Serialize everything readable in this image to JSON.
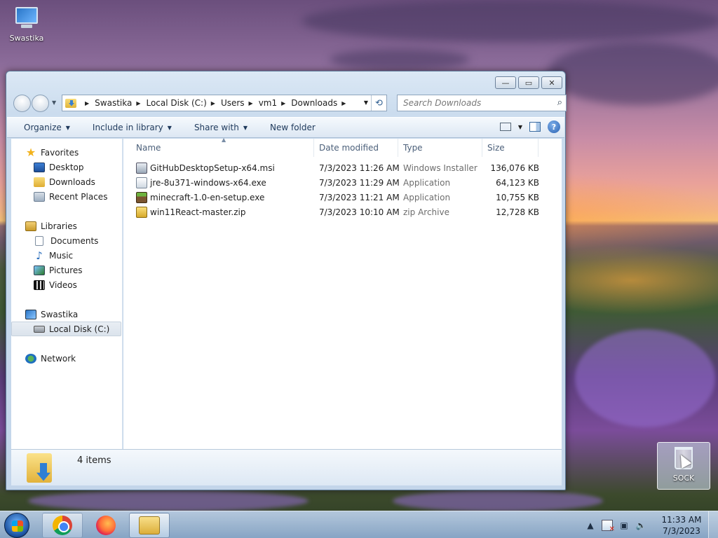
{
  "desktop": {
    "computer_icon": {
      "label": "Swastika",
      "icon": "computer-icon"
    },
    "recycle_bin": {
      "label": "SOCK",
      "icon": "recycle-bin-icon"
    }
  },
  "window": {
    "caption_buttons": {
      "minimize": "—",
      "maximize": "▭",
      "close": "✕"
    },
    "breadcrumb": [
      "Swastika",
      "Local Disk (C:)",
      "Users",
      "vm1",
      "Downloads"
    ],
    "search_placeholder": "Search Downloads",
    "commands": {
      "organize": "Organize",
      "include_in_library": "Include in library",
      "share_with": "Share with",
      "new_folder": "New folder"
    },
    "nav_pane": {
      "favorites": {
        "label": "Favorites",
        "items": [
          "Desktop",
          "Downloads",
          "Recent Places"
        ]
      },
      "libraries": {
        "label": "Libraries",
        "items": [
          "Documents",
          "Music",
          "Pictures",
          "Videos"
        ]
      },
      "computer": {
        "label": "Swastika",
        "items": [
          "Local Disk (C:)"
        ]
      },
      "network": {
        "label": "Network"
      },
      "selected": "Local Disk (C:)"
    },
    "columns": [
      "Name",
      "Date modified",
      "Type",
      "Size"
    ],
    "files": [
      {
        "name": "GitHubDesktopSetup-x64.msi",
        "date": "7/3/2023 11:26 AM",
        "type": "Windows Installer ...",
        "size": "136,076 KB",
        "icon": "msi-icon"
      },
      {
        "name": "jre-8u371-windows-x64.exe",
        "date": "7/3/2023 11:29 AM",
        "type": "Application",
        "size": "64,123 KB",
        "icon": "java-exe-icon"
      },
      {
        "name": "minecraft-1.0-en-setup.exe",
        "date": "7/3/2023 11:21 AM",
        "type": "Application",
        "size": "10,755 KB",
        "icon": "minecraft-icon"
      },
      {
        "name": "win11React-master.zip",
        "date": "7/3/2023 10:10 AM",
        "type": "zip Archive",
        "size": "12,728 KB",
        "icon": "zip-icon"
      }
    ],
    "status": {
      "item_count": "4 items"
    }
  },
  "taskbar": {
    "apps": [
      {
        "name": "chrome",
        "icon": "chrome-icon"
      },
      {
        "name": "firefox",
        "icon": "firefox-icon"
      },
      {
        "name": "explorer",
        "icon": "explorer-icon"
      }
    ],
    "clock": {
      "time": "11:33 AM",
      "date": "7/3/2023"
    }
  }
}
